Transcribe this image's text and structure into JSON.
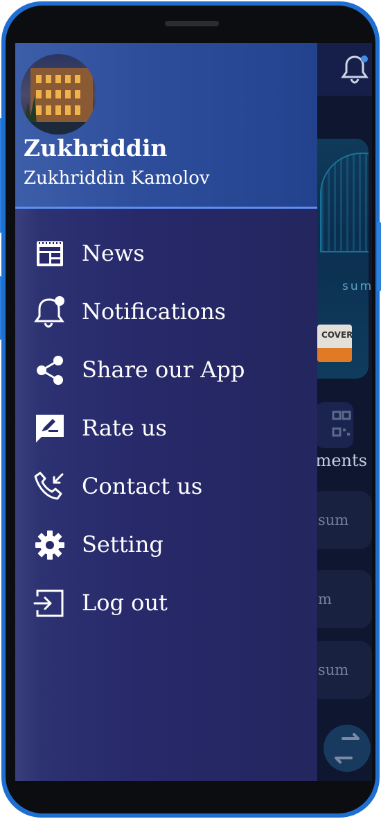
{
  "drawer": {
    "user": {
      "short_name": "Zukhriddin",
      "full_name": "Zukhriddin Kamolov"
    },
    "menu": [
      {
        "label": "News",
        "icon": "newspaper-icon"
      },
      {
        "label": "Notifications",
        "icon": "bell-icon"
      },
      {
        "label": "Share our App",
        "icon": "share-icon"
      },
      {
        "label": "Rate us",
        "icon": "rate-icon"
      },
      {
        "label": "Contact us",
        "icon": "phone-incoming-icon"
      },
      {
        "label": "Setting",
        "icon": "gear-icon"
      },
      {
        "label": "Log out",
        "icon": "logout-icon"
      }
    ]
  },
  "background": {
    "card_text": "sum",
    "card_brand": "COVER",
    "payments_label": "yments",
    "rows": [
      "sum",
      "m",
      "sum"
    ]
  },
  "colors": {
    "drawer": "#27296a",
    "drawer_header": "#2e4e9c",
    "accent_line": "#5b8ff0",
    "phone_frame": "#1f6fd0"
  }
}
